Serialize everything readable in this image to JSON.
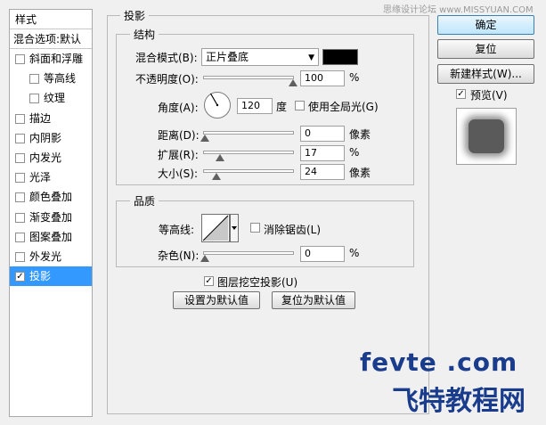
{
  "watermark_top": "思缘设计论坛 www.MISSYUAN.COM",
  "styles_panel": {
    "header": "样式",
    "blend_options": "混合选项:默认",
    "items": [
      {
        "label": "斜面和浮雕",
        "checked": false,
        "sub": false
      },
      {
        "label": "等高线",
        "checked": false,
        "sub": true
      },
      {
        "label": "纹理",
        "checked": false,
        "sub": true
      },
      {
        "label": "描边",
        "checked": false,
        "sub": false
      },
      {
        "label": "内阴影",
        "checked": false,
        "sub": false
      },
      {
        "label": "内发光",
        "checked": false,
        "sub": false
      },
      {
        "label": "光泽",
        "checked": false,
        "sub": false
      },
      {
        "label": "颜色叠加",
        "checked": false,
        "sub": false
      },
      {
        "label": "渐变叠加",
        "checked": false,
        "sub": false
      },
      {
        "label": "图案叠加",
        "checked": false,
        "sub": false
      },
      {
        "label": "外发光",
        "checked": false,
        "sub": false
      },
      {
        "label": "投影",
        "checked": true,
        "sub": false,
        "selected": true
      }
    ]
  },
  "drop_shadow": {
    "title": "投影",
    "structure": {
      "title": "结构",
      "blend_mode_label": "混合模式(B):",
      "blend_mode_value": "正片叠底",
      "shadow_color": "#000000",
      "opacity_label": "不透明度(O):",
      "opacity_value": "100",
      "opacity_unit": "%",
      "opacity_level": 100,
      "angle_label": "角度(A):",
      "angle_value": "120",
      "angle_unit": "度",
      "global_light_label": "使用全局光(G)",
      "global_light_checked": false,
      "distance_label": "距离(D):",
      "distance_value": "0",
      "distance_unit": "像素",
      "spread_label": "扩展(R):",
      "spread_value": "17",
      "spread_unit": "%",
      "size_label": "大小(S):",
      "size_value": "24",
      "size_unit": "像素"
    },
    "quality": {
      "title": "品质",
      "contour_label": "等高线:",
      "anti_alias_label": "消除锯齿(L)",
      "anti_alias_checked": false,
      "noise_label": "杂色(N):",
      "noise_value": "0",
      "noise_unit": "%"
    },
    "knockout_label": "图层挖空投影(U)",
    "knockout_checked": true,
    "make_default_label": "设置为默认值",
    "reset_default_label": "复位为默认值"
  },
  "right_panel": {
    "ok_label": "确定",
    "reset_label": "复位",
    "new_style_label": "新建样式(W)...",
    "preview_label": "预览(V)",
    "preview_checked": true
  },
  "watermark": {
    "line1": "fevte .com",
    "line2": "飞特教程网"
  }
}
